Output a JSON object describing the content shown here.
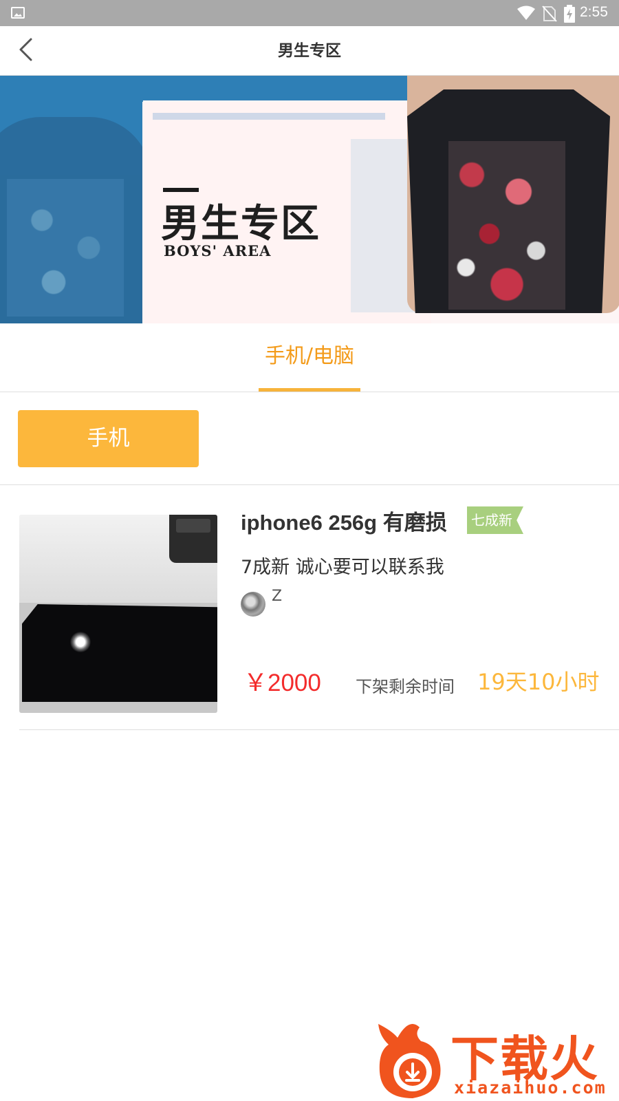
{
  "status_bar": {
    "time": "2:55",
    "icons": [
      "image-icon",
      "wifi-icon",
      "no-sim-icon",
      "battery-charging-icon"
    ]
  },
  "header": {
    "title": "男生专区",
    "back_icon": "chevron-left-icon"
  },
  "banner": {
    "title_cn": "男生专区",
    "title_en": "BOYS' AREA"
  },
  "tabs": [
    {
      "label": "手机/电脑",
      "active": true
    }
  ],
  "filters": [
    {
      "label": "手机",
      "selected": true
    }
  ],
  "products": [
    {
      "title": "iphone6 256g 有磨损",
      "condition": "七成新",
      "description": "7成新 诚心要可以联系我",
      "seller": "Z",
      "price": "￥2000",
      "remaining_label": "下架剩余时间",
      "remaining_value": "19天10小时"
    }
  ],
  "watermark": {
    "text": "下载火",
    "url": "xiazaihuo.com"
  },
  "colors": {
    "accent": "#f39b1a",
    "chip": "#fcb73c",
    "price": "#f32c2c",
    "badge": "#a8cf7e",
    "statusbar": "#a9a9a9"
  }
}
